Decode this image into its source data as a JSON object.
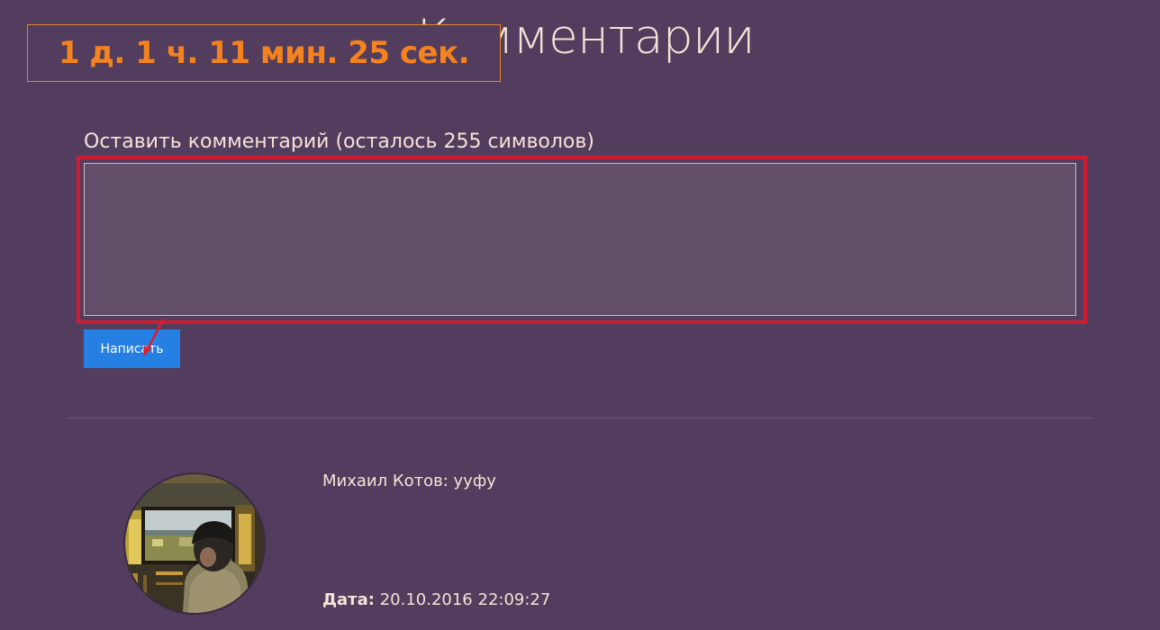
{
  "page": {
    "title": "Комментарии"
  },
  "timer": {
    "text": "1 д. 1 ч. 11 мин. 25 сек."
  },
  "comment_form": {
    "label": "Оставить комментарий (осталось 255 символов)",
    "textarea_value": "",
    "submit_label": "Написать"
  },
  "comments": [
    {
      "text": "Михаил Котов: ууфу",
      "date_label": "Дата:",
      "date_value": "20.10.2016 22:09:27"
    }
  ],
  "colors": {
    "background": "#523d5e",
    "text": "#f4e3d7",
    "timer_accent": "#f4821f",
    "highlight": "#cf1b2f",
    "button": "#2680e4",
    "textarea_bg": "#614f6a"
  },
  "icons": {
    "annotation": "red-arrow-icon"
  }
}
